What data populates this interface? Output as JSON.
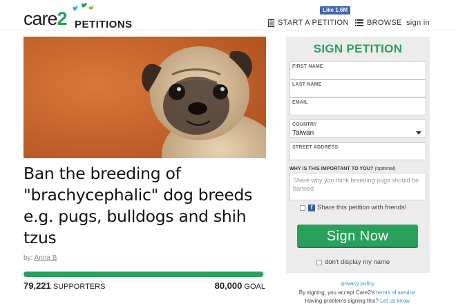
{
  "header": {
    "logo_care": "care",
    "logo_2": "2",
    "logo_petitions": "PETITIONS",
    "fb_like": "Like 1.6M",
    "nav_start": "START A PETITION",
    "nav_browse": "BROWSE",
    "nav_signin": "sign in"
  },
  "petition": {
    "title": "Ban the breeding of \"brachycephalic\" dog breeds e.g. pugs, bulldogs and shih tzus",
    "by_prefix": "by:",
    "author": "Anna B",
    "supporters_count": "79,221",
    "supporters_label": "SUPPORTERS",
    "goal_count": "80,000",
    "goal_label": "GOAL",
    "progress_fraction": 0.99
  },
  "form": {
    "heading": "SIGN PETITION",
    "first_name_label": "FIRST NAME",
    "last_name_label": "LAST NAME",
    "email_label": "EMAIL",
    "country_label": "COUNTRY",
    "country_value": "Taiwan",
    "street_label": "STREET ADDRESS",
    "why_label": "WHY IS THIS IMPORTANT TO YOU?",
    "why_optional": "(optional)",
    "why_placeholder": "Share why you think breeding pugs should be banned",
    "share_label": "Share this petition with friends!",
    "sign_button": "Sign Now",
    "dont_display": "don't display my name"
  },
  "footer": {
    "privacy": "privacy policy",
    "consent_prefix": "By signing, you accept Care2's",
    "consent_link": "terms of service.",
    "problems_prefix": "Having problems signing this?",
    "problems_link": "Let us know."
  },
  "colors": {
    "brand_green": "#2aa05a",
    "link_blue": "#2a8fb8",
    "panel_bg": "#ececec"
  }
}
